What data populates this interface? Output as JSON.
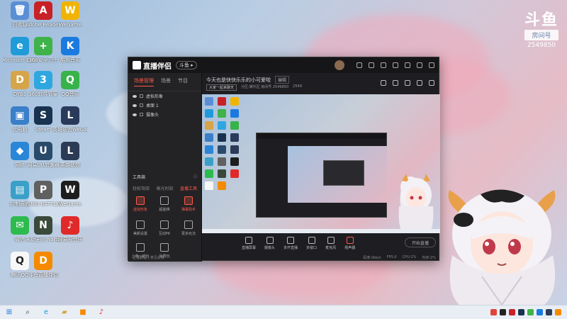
{
  "watermark": {
    "big": "斗鱼",
    "box": "房间号",
    "num": "2549850"
  },
  "desktop_icons": [
    {
      "label": "回收站",
      "color": "#5a8fd6",
      "glyph": "🗑"
    },
    {
      "label": "Adobe Reader XI",
      "color": "#c82127",
      "glyph": "A"
    },
    {
      "label": "WeGame",
      "color": "#f0b400",
      "glyph": "W"
    },
    {
      "label": "Microsoft Edge",
      "color": "#1f9bd9",
      "glyph": "e"
    },
    {
      "label": "360安全卫士",
      "color": "#3fb24a",
      "glyph": "+"
    },
    {
      "label": "酷狗音乐",
      "color": "#1b7ae0",
      "glyph": "K"
    },
    {
      "label": "DYBE",
      "color": "#d6a54a",
      "glyph": "D"
    },
    {
      "label": "360软件管家",
      "color": "#2ea7e0",
      "glyph": "3"
    },
    {
      "label": "QQ音乐",
      "color": "#37b34a",
      "glyph": "Q"
    },
    {
      "label": "此电脑",
      "color": "#3a7fc8",
      "glyph": "▣"
    },
    {
      "label": "Steam",
      "color": "#18324f",
      "glyph": "S"
    },
    {
      "label": "英雄联盟WeGame版",
      "color": "#2a3a5a",
      "glyph": "L"
    },
    {
      "label": "网络",
      "color": "#2a86d6",
      "glyph": "◆"
    },
    {
      "label": "网易UU加速器",
      "color": "#2a4a6a",
      "glyph": "U"
    },
    {
      "label": "英雄联盟",
      "color": "#2b3a55",
      "glyph": "L"
    },
    {
      "label": "控制面板",
      "color": "#3aa0c8",
      "glyph": "▤"
    },
    {
      "label": "PUBG BATTLEGR...",
      "color": "#606060",
      "glyph": "P"
    },
    {
      "label": "WeGame",
      "color": "#1d1d1d",
      "glyph": "W"
    },
    {
      "label": "微信",
      "color": "#2dbb4e",
      "glyph": "✉"
    },
    {
      "label": "永劫无间 Naraka...",
      "color": "#3a4a3a",
      "glyph": "N"
    },
    {
      "label": "网易云音乐",
      "color": "#e02a2a",
      "glyph": "♪"
    },
    {
      "label": "腾讯QQ",
      "color": "#f7f7f7",
      "glyph": "Q"
    },
    {
      "label": "斗鱼直播伴侣",
      "color": "#f58a00",
      "glyph": "D"
    }
  ],
  "app": {
    "logo": "直播伴侣",
    "badge": "斗鱼 ▸",
    "left_tabs": [
      "场景管理",
      "场景",
      "节目"
    ],
    "scenes": [
      "虚拟形象",
      "桌面 1",
      "摄像头"
    ],
    "tools_header": "工具箱",
    "tools_tabs": [
      "轻松驾驭",
      "高光时刻",
      "直播工具"
    ],
    "tools": [
      "虚拟形象",
      "超能棋",
      "弹幕助手",
      "美颜设置",
      "互动PK",
      "更多玩法",
      "上帝一起玩",
      "消费玩"
    ],
    "left_footer": "主播教程 | 意见反馈",
    "live_title": "今天也是快快乐乐的小可爱啦",
    "edit_label": "编辑",
    "live_sub_tag": "大家一起来聊天",
    "live_sub_room": "分区:娱乐区 房间号 2549850",
    "live_sub_extra": "2549",
    "bottom_tools": [
      "直播屏幕",
      "摄像头",
      "多开直播",
      "多窗口",
      "麦克风",
      "扬声器"
    ],
    "start_live": "开始直播",
    "status_items": [
      "码率:0kb/s",
      "FPS:0",
      "CPU:2%",
      "内存:2%"
    ]
  }
}
